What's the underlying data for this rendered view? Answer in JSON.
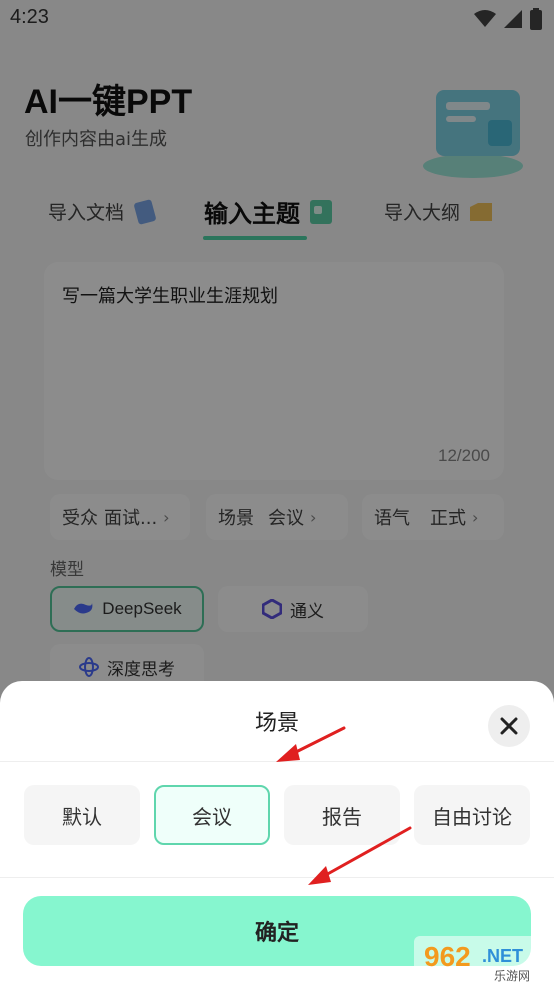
{
  "status_bar": {
    "time": "4:23"
  },
  "header": {
    "title": "AI一键PPT",
    "subtitle": "创作内容由ai生成"
  },
  "tabs": [
    {
      "label": "导入文档",
      "icon": "document-icon"
    },
    {
      "label": "输入主题",
      "icon": "topic-card-icon",
      "active": true
    },
    {
      "label": "导入大纲",
      "icon": "outline-icon"
    }
  ],
  "prompt": {
    "text": "写一篇大学生职业生涯规划",
    "count": "12/200"
  },
  "options_row": [
    {
      "label": "受众",
      "value": "面试..."
    },
    {
      "label": "场景",
      "value": "会议"
    },
    {
      "label": "语气",
      "value": "正式"
    }
  ],
  "model": {
    "label": "模型",
    "items": [
      {
        "label": "DeepSeek",
        "icon": "deepseek-whale-icon",
        "selected": true
      },
      {
        "label": "通义",
        "icon": "tongyi-icon"
      },
      {
        "label": "深度思考",
        "icon": "deep-think-icon"
      }
    ]
  },
  "sheet": {
    "title": "场景",
    "options": [
      "默认",
      "会议",
      "报告",
      "自由讨论"
    ],
    "selected": "会议",
    "confirm_label": "确定"
  },
  "watermark": {
    "text": "962.NET",
    "sub": "乐游网"
  },
  "colors": {
    "accent": "#86f6cf",
    "selected_border": "#5fd6ad",
    "arrow": "#e02020"
  }
}
